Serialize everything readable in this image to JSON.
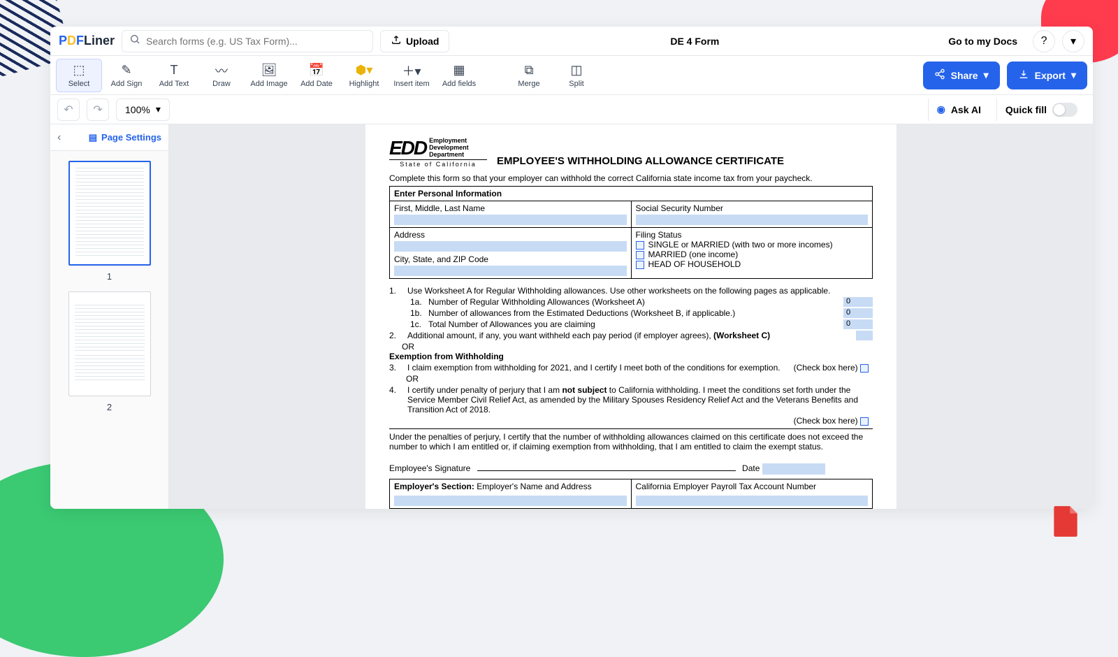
{
  "app": {
    "logo_p": "P",
    "logo_d": "D",
    "logo_f": "F",
    "logo_rest": "Liner"
  },
  "topbar": {
    "search_placeholder": "Search forms (e.g. US Tax Form)...",
    "upload": "Upload",
    "form_name": "DE 4 Form",
    "goto_docs": "Go to my Docs"
  },
  "toolbar": {
    "select": "Select",
    "add_sign": "Add Sign",
    "add_text": "Add Text",
    "draw": "Draw",
    "add_image": "Add Image",
    "add_date": "Add Date",
    "highlight": "Highlight",
    "insert_item": "Insert item",
    "add_fields": "Add fields",
    "merge": "Merge",
    "split": "Split",
    "share": "Share",
    "export": "Export"
  },
  "subbar": {
    "zoom": "100%",
    "ask_ai": "Ask AI",
    "quick_fill": "Quick fill"
  },
  "sidebar": {
    "page_settings": "Page Settings",
    "page1": "1",
    "page2": "2"
  },
  "doc": {
    "edd_line1": "Employment",
    "edd_line2": "Development",
    "edd_line3": "Department",
    "edd_state": "State of California",
    "title": "EMPLOYEE'S WITHHOLDING ALLOWANCE CERTIFICATE",
    "intro": "Complete this form so that your employer can withhold the correct California state income tax from your paycheck.",
    "section_head": "Enter Personal Information",
    "name_label": "First, Middle, Last Name",
    "ssn_label": "Social Security Number",
    "address_label": "Address",
    "city_label": "City, State, and ZIP Code",
    "filing_label": "Filing Status",
    "filing_opt1": "SINGLE or MARRIED (with two or more incomes)",
    "filing_opt2": "MARRIED (one income)",
    "filing_opt3": "HEAD OF HOUSEHOLD",
    "item1": "Use Worksheet A for Regular Withholding allowances. Use other worksheets on the following pages as applicable.",
    "item1a": "Number of Regular Withholding Allowances (Worksheet A)",
    "item1b": "Number of allowances from the Estimated Deductions (Worksheet B, if applicable.)",
    "item1c": "Total Number of Allowances you are claiming",
    "val1a": "0",
    "val1b": "0",
    "val1c": "0",
    "item2a": "Additional amount, if any, you want withheld each pay period (if employer agrees), ",
    "item2b": "(Worksheet  C)",
    "or": "OR",
    "exempt_head": "Exemption from Withholding",
    "item3": "I claim exemption from withholding for 2021, and I certify I meet both of the conditions for exemption.",
    "item4a": "I certify under penalty of perjury that I am ",
    "item4b": "not subject",
    "item4c": " to California withholding. I meet the conditions set forth under the Service Member Civil Relief Act, as amended by the Military Spouses Residency Relief Act and the Veterans Benefits and Transition Act of 2018.",
    "check_here": "(Check box here)",
    "penalty": "Under the penalties of perjury, I certify that the number of withholding allowances claimed on this certificate does not exceed the number to which I am entitled or, if claiming exemption from withholding, that I am entitled to claim the exempt status.",
    "sig_label": "Employee's Signature",
    "date_label": "Date",
    "emp_section": "Employer's Section:",
    "emp_name": " Employer's Name and Address",
    "emp_acct": "California Employer Payroll Tax Account Number"
  }
}
